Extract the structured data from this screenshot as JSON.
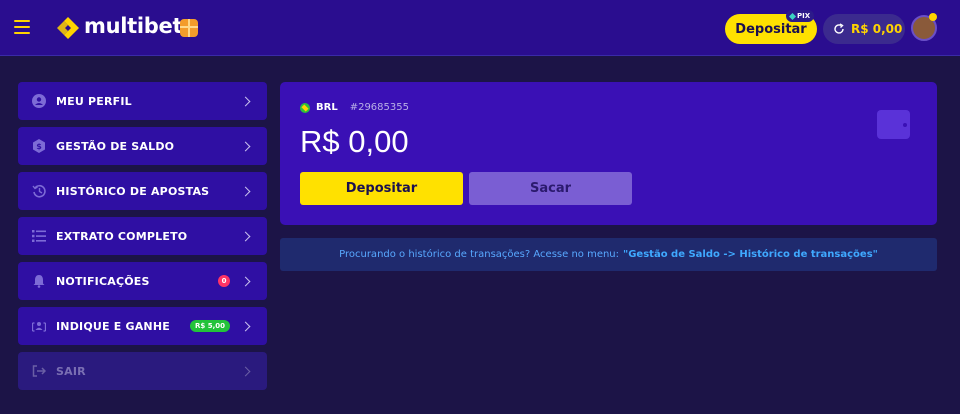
{
  "header": {
    "brand": "multibet",
    "deposit_label": "Depositar",
    "pix_label": "PIX",
    "balance": "R$ 0,00"
  },
  "menu": {
    "items": [
      {
        "label": "MEU PERFIL",
        "icon": "user-icon"
      },
      {
        "label": "GESTÃO DE SALDO",
        "icon": "dollar-icon"
      },
      {
        "label": "HISTÓRICO DE APOSTAS",
        "icon": "history-icon"
      },
      {
        "label": "EXTRATO COMPLETO",
        "icon": "list-icon"
      },
      {
        "label": "NOTIFICAÇÕES",
        "icon": "bell-icon",
        "badge": "0"
      },
      {
        "label": "INDIQUE E GANHE",
        "icon": "referral-icon",
        "badge": "R$ 5,00"
      },
      {
        "label": "SAIR",
        "icon": "logout-icon"
      }
    ]
  },
  "wallet": {
    "currency": "BRL",
    "account_id": "#29685355",
    "balance": "R$ 0,00",
    "deposit_label": "Depositar",
    "withdraw_label": "Sacar"
  },
  "info": {
    "text": "Procurando o histórico de transações? Acesse no menu:",
    "highlight": "\"Gestão de Saldo -> Histórico de transações\""
  },
  "colors": {
    "accent": "#ffe100",
    "header_bg": "#2a0d8f",
    "card_bg": "#3a10b5",
    "menu_bg": "#2f0fa3",
    "page_bg": "#1c1447",
    "link": "#3fa9ff"
  }
}
